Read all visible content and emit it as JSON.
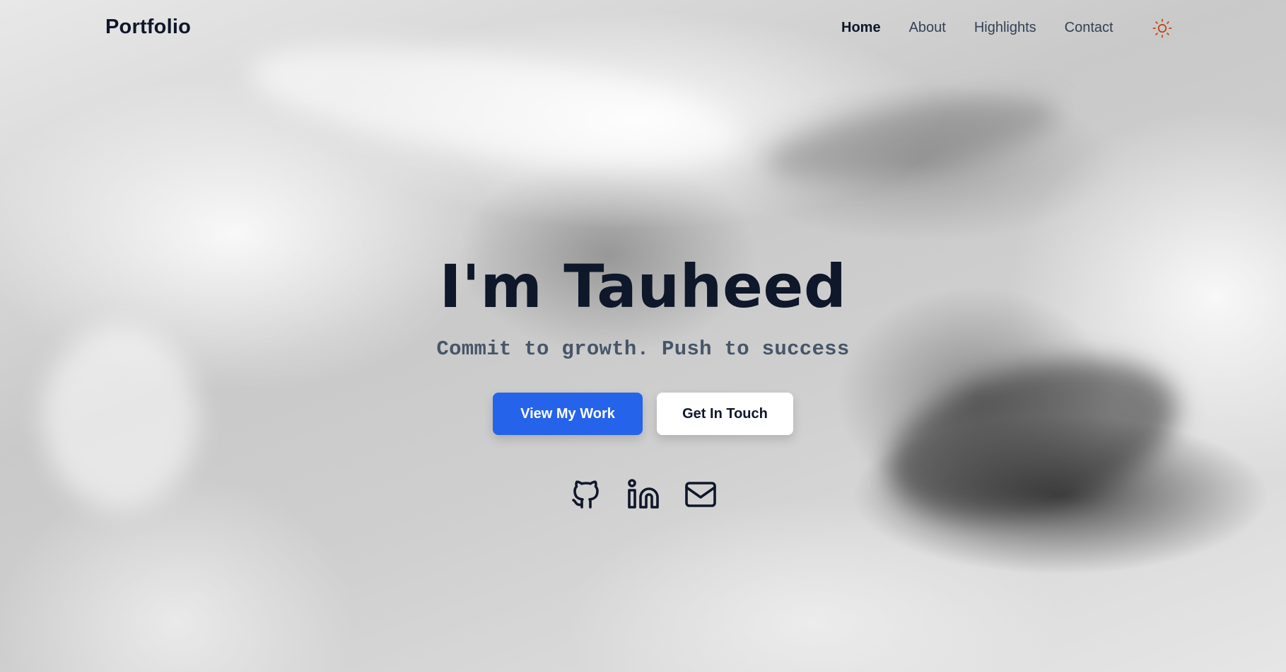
{
  "nav": {
    "brand": "Portfolio",
    "links": [
      {
        "label": "Home",
        "active": true
      },
      {
        "label": "About",
        "active": false
      },
      {
        "label": "Highlights",
        "active": false
      },
      {
        "label": "Contact",
        "active": false
      }
    ],
    "theme_toggle_icon": "sun-icon"
  },
  "hero": {
    "title": "I'm Tauheed",
    "subtitle": "Commit to growth. Push to success"
  },
  "cta": {
    "primary_label": "View My Work",
    "secondary_label": "Get In Touch"
  },
  "socials": [
    {
      "icon": "github-icon"
    },
    {
      "icon": "linkedin-icon"
    },
    {
      "icon": "mail-icon"
    }
  ],
  "colors": {
    "text_dark": "#0f172a",
    "text_muted": "#475569",
    "primary": "#2563eb",
    "theme_icon": "#c2410c"
  }
}
